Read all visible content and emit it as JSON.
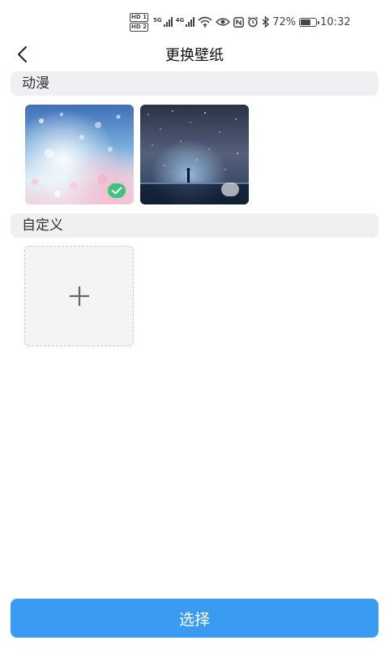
{
  "status_bar": {
    "hd1": "HD 1",
    "hd2": "HD 2",
    "net1": "5G",
    "net2": "4G",
    "battery_percent": "72%",
    "battery_level": 0.72,
    "time": "10:32",
    "icons": [
      "wifi-icon",
      "eye-icon",
      "nfc-icon",
      "alarm-icon",
      "bluetooth-icon",
      "battery-icon"
    ]
  },
  "nav": {
    "title": "更换壁纸",
    "back_icon": "chevron-left-icon"
  },
  "sections": {
    "anime": {
      "label": "动漫",
      "wallpapers": [
        {
          "name": "anime-wallpaper-1",
          "selected": true
        },
        {
          "name": "anime-wallpaper-2",
          "selected": false
        }
      ]
    },
    "custom": {
      "label": "自定义",
      "add_icon": "plus-icon"
    }
  },
  "footer": {
    "select_label": "选择"
  },
  "colors": {
    "accent": "#3a9bf2",
    "selected_check": "#3ec37a",
    "section_bg": "#f0f0f2"
  }
}
